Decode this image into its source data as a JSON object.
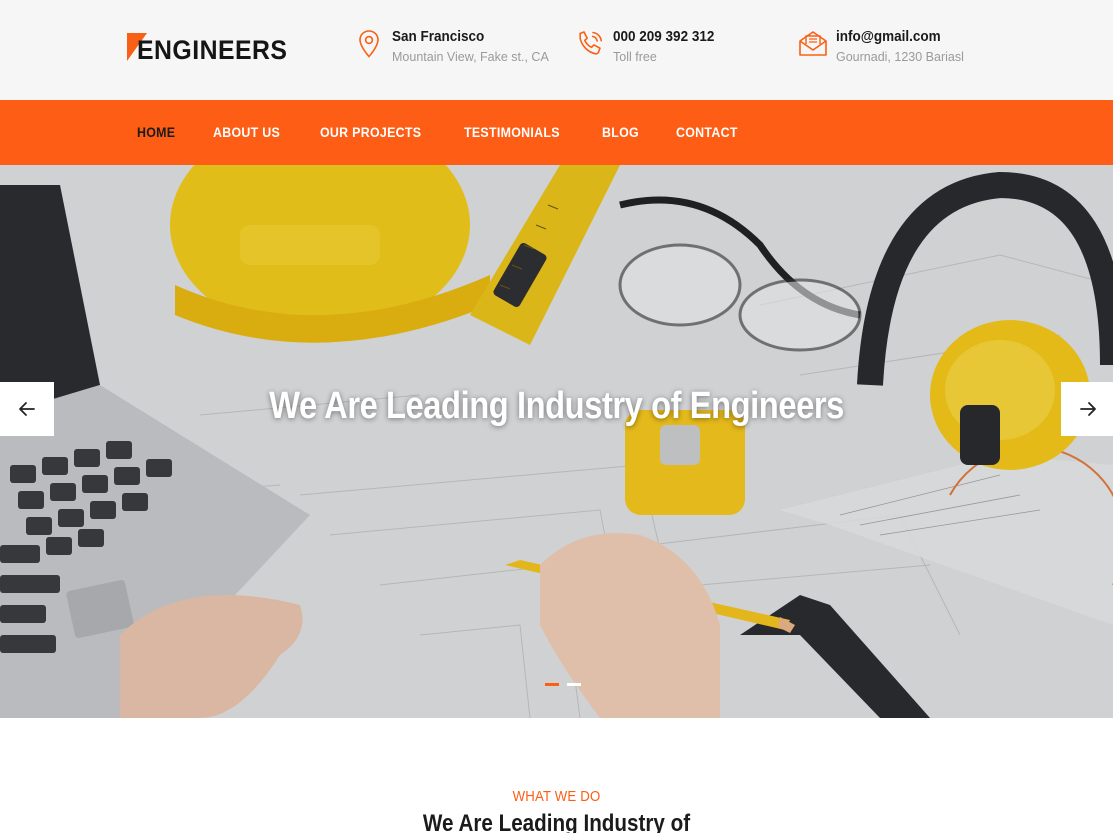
{
  "brand": {
    "logo_text": "ENGINEERS"
  },
  "contacts": {
    "location": {
      "title": "San Francisco",
      "subtitle": "Mountain View, Fake st., CA",
      "icon": "map-pin-icon"
    },
    "phone": {
      "title": "000 209 392 312",
      "subtitle": "Toll free",
      "icon": "phone-icon"
    },
    "email": {
      "title": "info@gmail.com",
      "subtitle": "Gournadi, 1230 Bariasl",
      "icon": "envelope-icon"
    }
  },
  "nav": {
    "items": [
      {
        "label": "HOME",
        "active": true
      },
      {
        "label": "ABOUT US",
        "active": false
      },
      {
        "label": "OUR PROJECTS",
        "active": false
      },
      {
        "label": "TESTIMONIALS",
        "active": false
      },
      {
        "label": "BLOG",
        "active": false
      },
      {
        "label": "CONTACT",
        "active": false
      }
    ]
  },
  "hero": {
    "title_before": "We Are ",
    "title_bold": "Leading",
    "title_after": " Industry of Engineers",
    "slides_count": 2,
    "active_slide": 1
  },
  "section": {
    "kicker": "WHAT WE DO",
    "heading_before": "We Are ",
    "heading_bold": "Leading Industry",
    "heading_after": " of"
  },
  "colors": {
    "accent": "#fd5d14",
    "header_bg": "#f6f6f7",
    "dark_text": "#1c1c1c"
  }
}
